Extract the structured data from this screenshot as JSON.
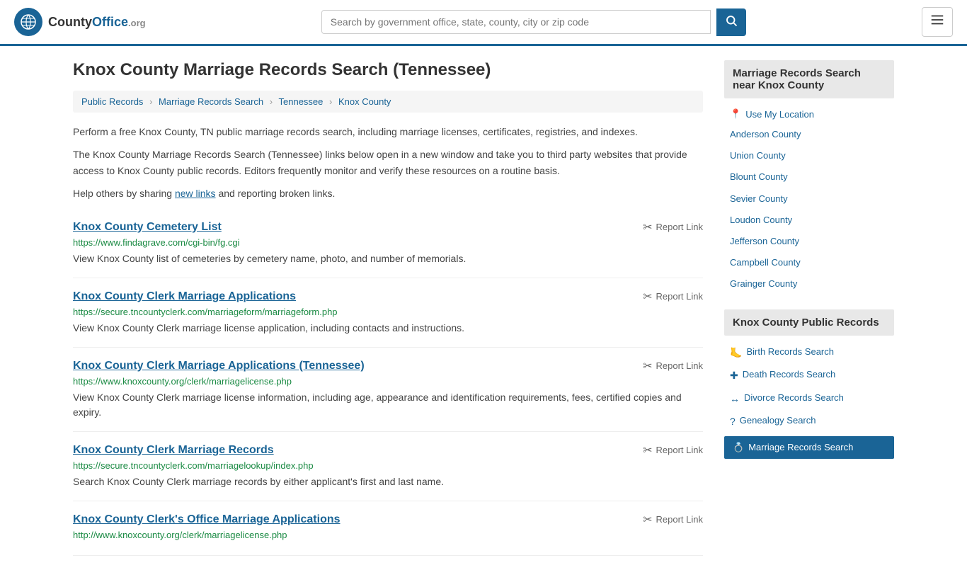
{
  "header": {
    "logo_icon": "🌐",
    "logo_name": "CountyOffice",
    "logo_org": ".org",
    "search_placeholder": "Search by government office, state, county, city or zip code",
    "search_icon": "🔍",
    "menu_icon": "≡"
  },
  "page": {
    "title": "Knox County Marriage Records Search (Tennessee)",
    "breadcrumb": [
      {
        "label": "Public Records",
        "link": "#"
      },
      {
        "label": "Marriage Records Search",
        "link": "#"
      },
      {
        "label": "Tennessee",
        "link": "#"
      },
      {
        "label": "Knox County",
        "link": "#"
      }
    ],
    "description1": "Perform a free Knox County, TN public marriage records search, including marriage licenses, certificates, registries, and indexes.",
    "description2": "The Knox County Marriage Records Search (Tennessee) links below open in a new window and take you to third party websites that provide access to Knox County public records. Editors frequently monitor and verify these resources on a routine basis.",
    "description3_pre": "Help others by sharing ",
    "description3_link": "new links",
    "description3_post": " and reporting broken links."
  },
  "results": [
    {
      "title": "Knox County Cemetery List",
      "url": "https://www.findagrave.com/cgi-bin/fg.cgi",
      "desc": "View Knox County list of cemeteries by cemetery name, photo, and number of memorials.",
      "report": "Report Link"
    },
    {
      "title": "Knox County Clerk Marriage Applications",
      "url": "https://secure.tncountyclerk.com/marriageform/marriageform.php",
      "desc": "View Knox County Clerk marriage license application, including contacts and instructions.",
      "report": "Report Link"
    },
    {
      "title": "Knox County Clerk Marriage Applications (Tennessee)",
      "url": "https://www.knoxcounty.org/clerk/marriagelicense.php",
      "desc": "View Knox County Clerk marriage license information, including age, appearance and identification requirements, fees, certified copies and expiry.",
      "report": "Report Link"
    },
    {
      "title": "Knox County Clerk Marriage Records",
      "url": "https://secure.tncountyclerk.com/marriagelookup/index.php",
      "desc": "Search Knox County Clerk marriage records by either applicant's first and last name.",
      "report": "Report Link"
    },
    {
      "title": "Knox County Clerk's Office Marriage Applications",
      "url": "http://www.knoxcounty.org/clerk/marriagelicense.php",
      "desc": "",
      "report": "Report Link"
    }
  ],
  "sidebar": {
    "section1_title": "Marriage Records Search near Knox County",
    "use_location": "Use My Location",
    "nearby_counties": [
      "Anderson County",
      "Union County",
      "Blount County",
      "Sevier County",
      "Loudon County",
      "Jefferson County",
      "Campbell County",
      "Grainger County"
    ],
    "section2_title": "Knox County Public Records",
    "public_records": [
      {
        "icon": "🦶",
        "label": "Birth Records Search"
      },
      {
        "icon": "✚",
        "label": "Death Records Search"
      },
      {
        "icon": "↔",
        "label": "Divorce Records Search"
      },
      {
        "icon": "?",
        "label": "Genealogy Search"
      },
      {
        "icon": "💍",
        "label": "Marriage Records Search"
      }
    ]
  }
}
